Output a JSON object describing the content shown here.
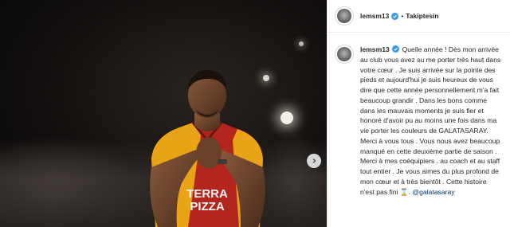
{
  "header": {
    "username": "lemsm13",
    "separator": "•",
    "follow_label": "Takiptesin"
  },
  "caption": {
    "username": "lemsm13",
    "text": "Quelle année ! Dès mon arrivée au club vous avez su me porter très haut dans votre cœur . Je suis arrivée sur la pointe des pieds et aujourd'hui je suis heureux de vous dire que cette année personnellement m'a fait beaucoup grandir . Dans les bons comme dans les mauvais moments je suis fier et honoré d'avoir pu au moins une fois dans ma vie porter les couleurs de GALATASARAY. Merci à vous tous . Vous nous avez beaucoup manqué en cette deuxième partie de saison . Merci à mes coéquipiers . au coach et au staff tout entier . Je vous aimes du plus profond de mon cœur et à très bientôt . Cette histoire n'est pas fini ",
    "emoji": "⌛",
    "mention": "@galatasaray"
  },
  "media": {
    "jersey_sponsor_line1": "TERRA",
    "jersey_sponsor_line2": "PIZZA"
  },
  "colors": {
    "verified": "#3897f0",
    "jersey_red": "#b3261e",
    "jersey_yellow": "#e8a317",
    "mention": "#00376b"
  },
  "icons": {
    "next": "chevron-right-icon",
    "verified": "verified-badge-icon"
  }
}
